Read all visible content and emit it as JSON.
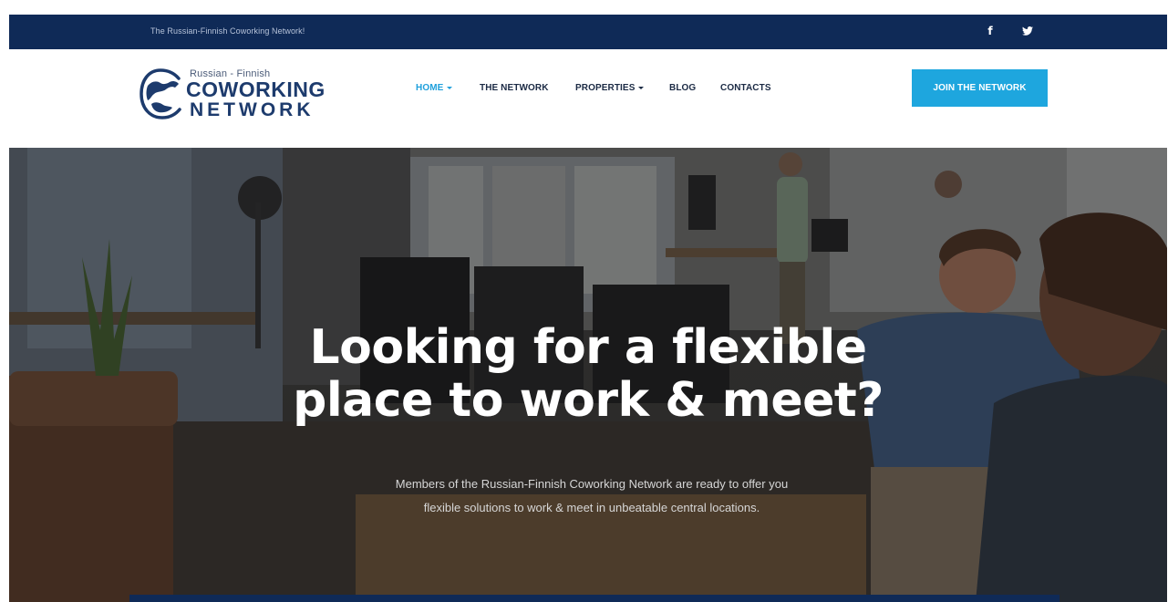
{
  "topbar": {
    "tagline": "The Russian-Finnish Coworking Network!",
    "social": [
      {
        "icon": "facebook-icon",
        "glyph": "f"
      },
      {
        "icon": "twitter-icon"
      }
    ]
  },
  "logo": {
    "line1": "Russian - Finnish",
    "line2": "COWORKING",
    "line3": "NETWORK"
  },
  "nav": {
    "items": [
      {
        "label": "HOME",
        "has_caret": true,
        "active": true
      },
      {
        "label": "THE NETWORK",
        "has_caret": false,
        "active": false
      },
      {
        "label": "PROPERTIES",
        "has_caret": true,
        "active": false
      },
      {
        "label": "BLOG",
        "has_caret": false,
        "active": false
      },
      {
        "label": "CONTACTS",
        "has_caret": false,
        "active": false
      }
    ],
    "cta": "JOIN THE NETWORK"
  },
  "hero": {
    "headline_line1": "Looking for a flexible",
    "headline_line2": "place to work & meet?",
    "subtext": "Members of the Russian-Finnish Coworking Network are ready to offer you flexible solutions to work & meet in unbeatable central locations."
  },
  "colors": {
    "navy": "#0f2a57",
    "accent": "#1ea6de",
    "nav_text": "#1b2a44"
  }
}
